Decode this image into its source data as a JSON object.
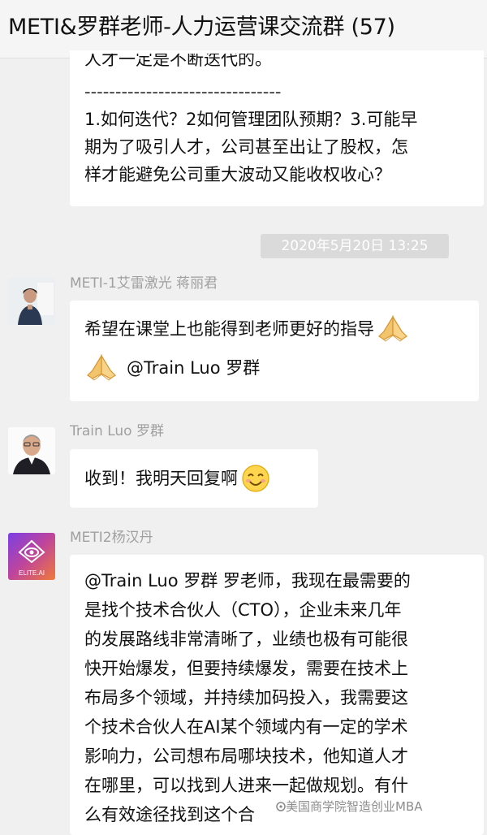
{
  "window": {
    "title": "METI&罗群老师-人力运营课交流群 (57)"
  },
  "messages": [
    {
      "id": "prev",
      "lines": [
        "人才一定是不断迭代的。",
        "--------------------------------",
        "1.如何迭代？2如何管理团队预期？3.可能早",
        "期为了吸引人才，公司甚至出让了股权，怎",
        "样才能避免公司重大波动又能收权收心？"
      ]
    }
  ],
  "timestamp": "2020年5月20日 13:25",
  "msg1": {
    "sender": "METI-1艾雷激光  蒋丽君",
    "line1": "希望在课堂上也能得到老师更好的指导",
    "line2": "@Train Luo 罗群",
    "emoji": "folded-hands"
  },
  "msg2": {
    "sender": "Train Luo 罗群",
    "text": "收到！我明天回复啊",
    "emoji": "smiling-face"
  },
  "msg3": {
    "sender": "METI2杨汉丹",
    "avatar_label": "ELITE.AI",
    "lines": [
      "@Train Luo 罗群 罗老师，我现在最需要的",
      "是找个技术合伙人（CTO），企业未来几年",
      "的发展路线非常清晰了，业绩也极有可能很",
      "快开始爆发，但要持续爆发，需要在技术上",
      "布局多个领域，并持续加码投入，我需要这",
      "个技术合伙人在AI某个领域内有一定的学术",
      "影响力，公司想布局哪块技术，他知道人才",
      "在哪里，可以找到人进来一起做规划。有什",
      "么有效途径找到这个合"
    ]
  },
  "watermark": "美国商学院智造创业MBA",
  "colors": {
    "bubble": "#ffffff",
    "background": "#f0f0f0",
    "sender": "#a0a0a0",
    "timestamp_bg": "#dadada"
  }
}
